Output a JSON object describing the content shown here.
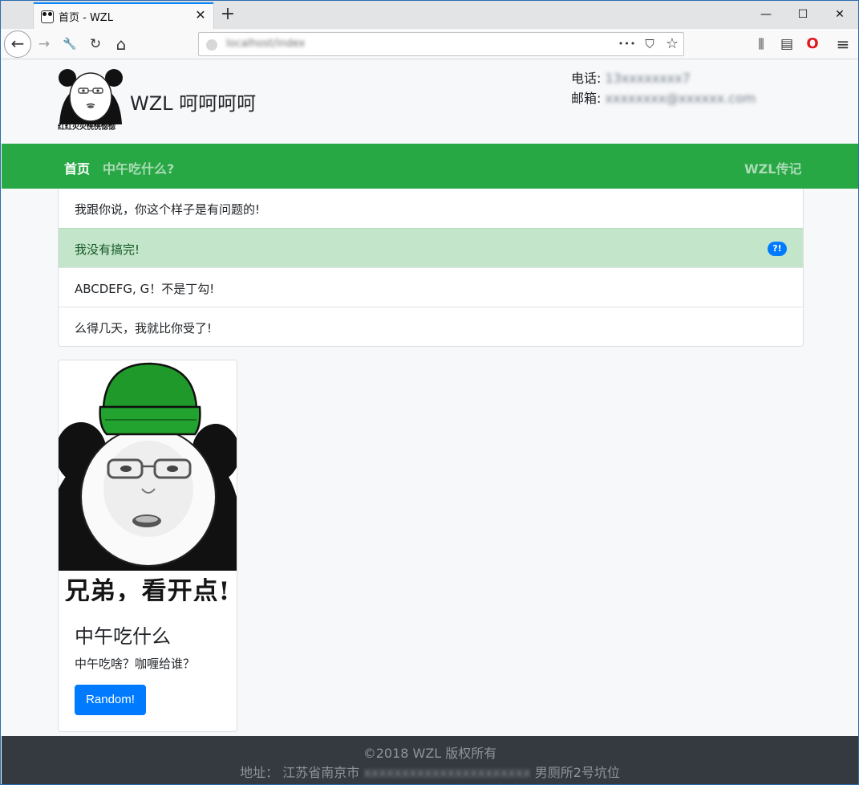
{
  "browser": {
    "tab_title": "首页 - WZL",
    "tab_close_glyph": "✕",
    "new_tab_glyph": "+",
    "window_controls": {
      "minimize": "—",
      "maximize": "☐",
      "close": "✕"
    },
    "url": "localhost/index",
    "url_actions": {
      "more": "•••",
      "pocket": "⛉",
      "star": "☆"
    },
    "toolbar_glyphs": {
      "back": "←",
      "forward": "→",
      "tools": "🔧",
      "reload": "↻",
      "home": "⌂",
      "library": "⫼",
      "sidebar": "▤",
      "opera": "O",
      "menu": "≡"
    }
  },
  "header": {
    "logo_caption": "红红火火恍恍惚惚",
    "brand": "WZL 呵呵呵呵",
    "phone_label": "电话:",
    "phone_value": "13xxxxxxxx7",
    "email_label": "邮箱:",
    "email_value": "xxxxxxxx@xxxxxx.com"
  },
  "nav": {
    "home": "首页",
    "lunch": "中午吃什么?",
    "bio": "WZL传记"
  },
  "list": {
    "items": [
      {
        "text": "我跟你说，你这个样子是有问题的!"
      },
      {
        "text": "我没有搞完!",
        "badge": "?!"
      },
      {
        "text": "ABCDEFG, G！不是丁勾!"
      },
      {
        "text": "么得几天，我就比你受了!"
      }
    ]
  },
  "card": {
    "image_caption": "兄弟，看开点!",
    "title": "中午吃什么",
    "text": "中午吃啥？咖喱给谁？",
    "button": "Random!"
  },
  "footer": {
    "copyright": "©2018 WZL 版权所有",
    "address_label": "地址：",
    "address_city": "江苏省南京市",
    "address_blurred": "xxxxxxxxxxxxxxxxxxxxxx",
    "address_tail": "男厕所2号坑位"
  },
  "colors": {
    "navbar": "#28a745",
    "success_item": "#c3e6cb",
    "primary": "#007bff",
    "footer": "#343a40"
  }
}
